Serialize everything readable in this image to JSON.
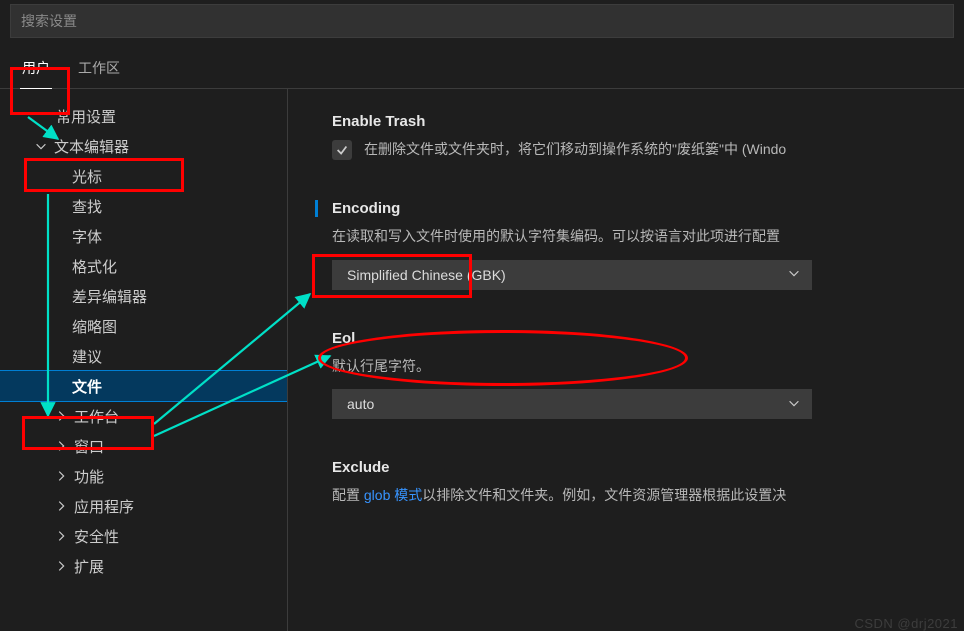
{
  "search": {
    "placeholder": "搜索设置"
  },
  "tabs": {
    "user": "用户",
    "workspace": "工作区"
  },
  "sidebar": {
    "common": "常用设置",
    "textEditor": "文本编辑器",
    "cursor": "光标",
    "find": "查找",
    "font": "字体",
    "formatting": "格式化",
    "diffEditor": "差异编辑器",
    "minimap": "缩略图",
    "suggestions": "建议",
    "files": "文件",
    "workbench": "工作台",
    "window": "窗口",
    "features": "功能",
    "application": "应用程序",
    "security": "安全性",
    "extensions": "扩展"
  },
  "settings": {
    "enableTrash": {
      "title": "Enable Trash",
      "desc": "在删除文件或文件夹时，将它们移动到操作系统的\"废纸篓\"中 (Windo"
    },
    "encoding": {
      "title": "Encoding",
      "desc": "在读取和写入文件时使用的默认字符集编码。可以按语言对此项进行配置",
      "value": "Simplified Chinese (GBK)"
    },
    "eol": {
      "title": "Eol",
      "desc": "默认行尾字符。",
      "value": "auto"
    },
    "exclude": {
      "title": "Exclude",
      "descPrefix": "配置 ",
      "descLink": "glob 模式",
      "descSuffix": "以排除文件和文件夹。例如，文件资源管理器根据此设置决"
    }
  },
  "watermark": "CSDN @drj2021"
}
